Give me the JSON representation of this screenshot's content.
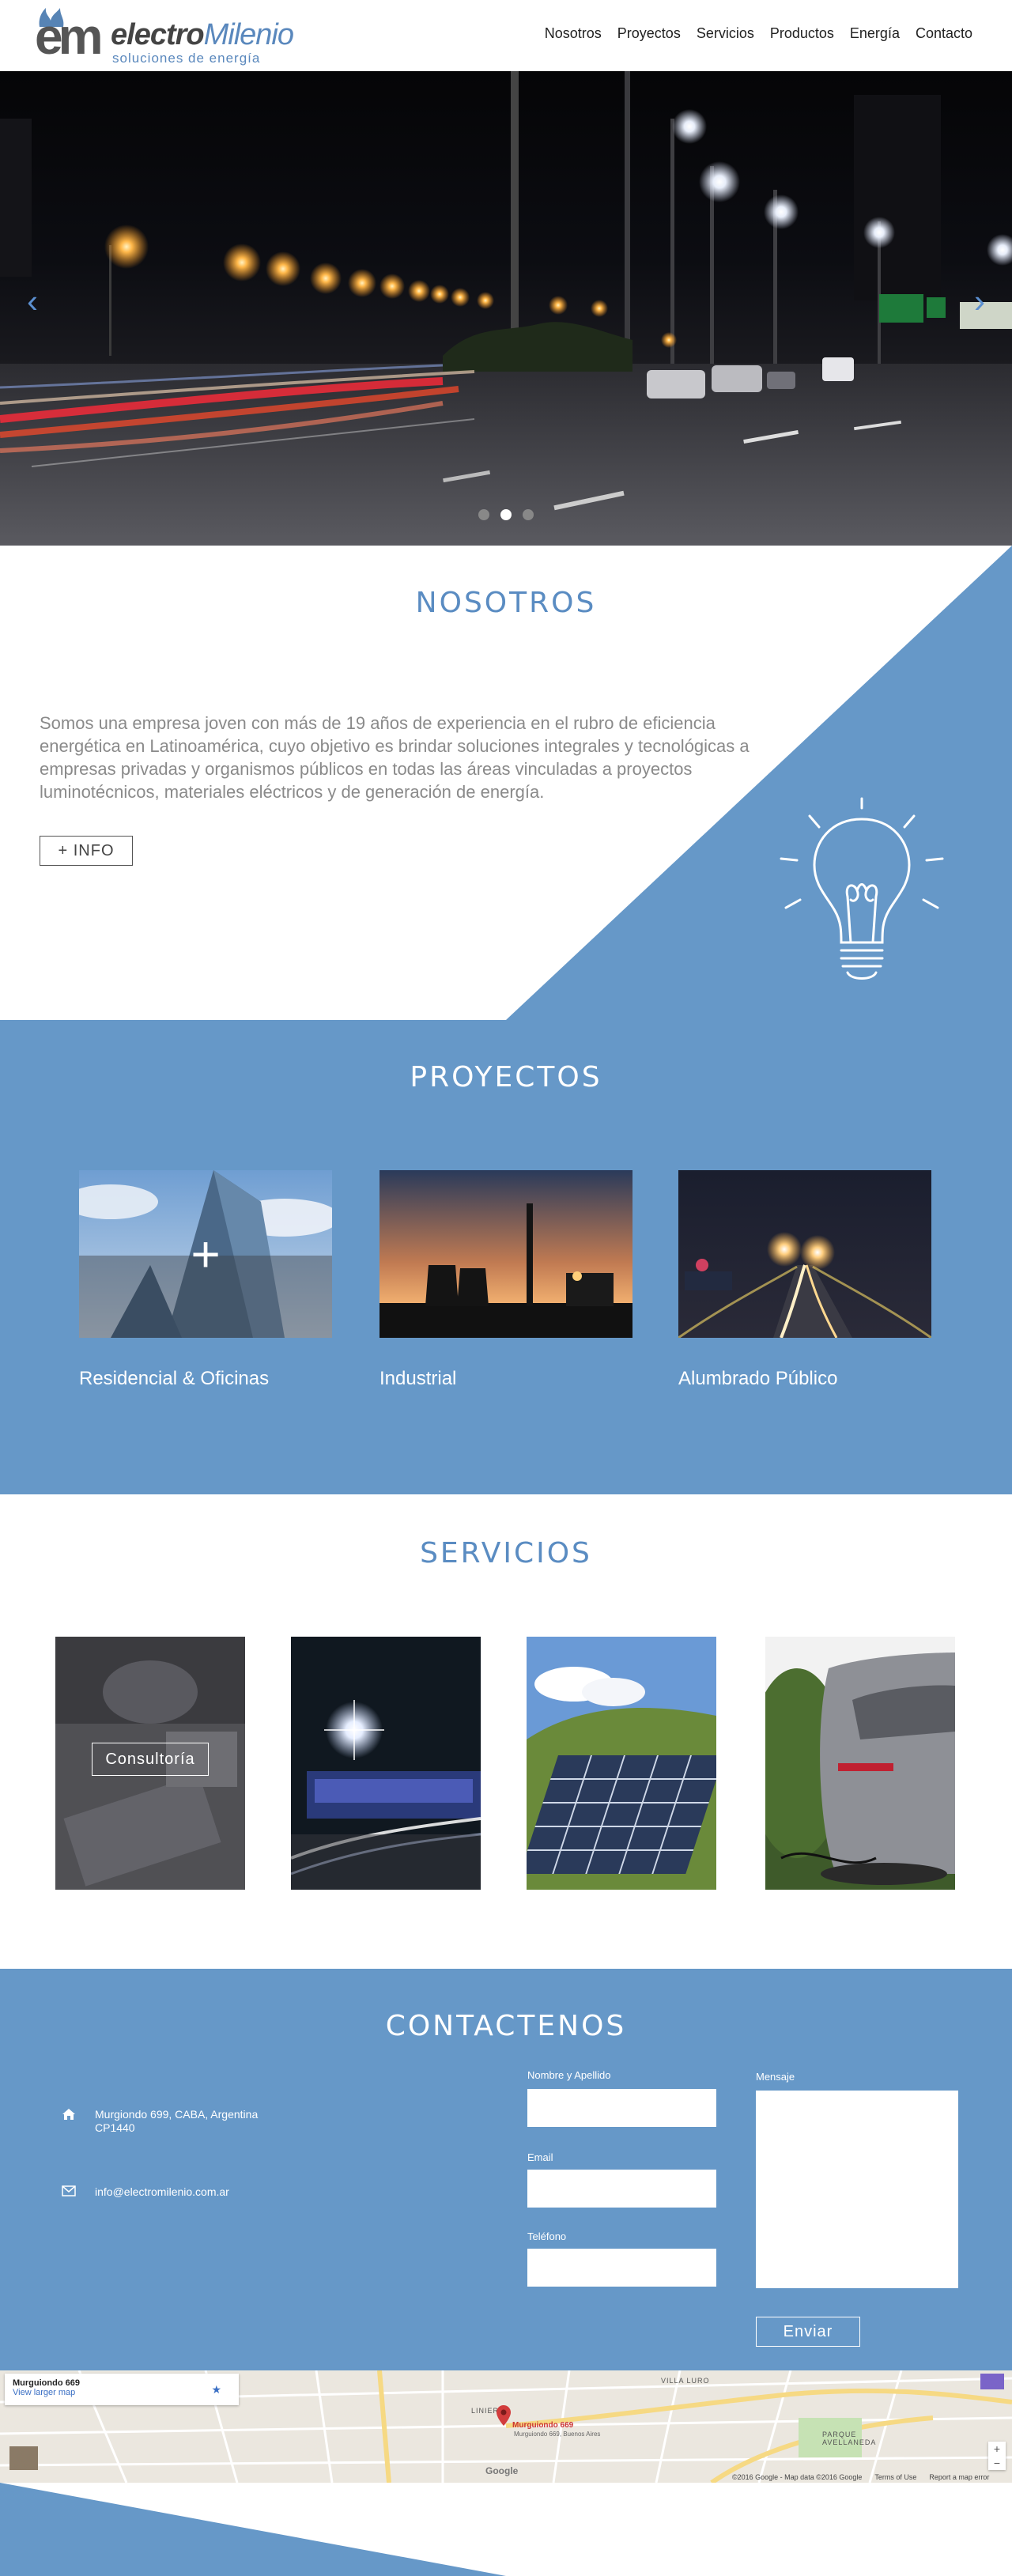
{
  "brand": {
    "logo_em": "em",
    "name_part1": "electro",
    "name_part2": "Milenio",
    "tagline": "soluciones de energía",
    "accent": "#6698c8",
    "accent_dark": "#3a6ea8"
  },
  "nav": {
    "items": [
      "Nosotros",
      "Proyectos",
      "Servicios",
      "Productos",
      "Energía",
      "Contacto"
    ]
  },
  "hero": {
    "prev_icon": "chevron-left-icon",
    "next_icon": "chevron-right-icon",
    "prev_glyph": "‹",
    "next_glyph": "›",
    "slides": 3,
    "active_slide": 2
  },
  "nosotros": {
    "title": "NOSOTROS",
    "text": "Somos una empresa joven con más de 19 años de experiencia en el rubro de eficiencia energética en Latinoamérica, cuyo objetivo es brindar soluciones integrales y tecnológicas a empresas privadas y organismos públicos en todas las áreas vinculadas a proyectos luminotécnicos, materiales eléctricos y de  generación de energía.",
    "button": "+ INFO",
    "icon": "lightbulb-icon"
  },
  "proyectos": {
    "title": "PROYECTOS",
    "items": [
      {
        "label": "Residencial & Oficinas",
        "hover_plus": "+"
      },
      {
        "label": "Industrial"
      },
      {
        "label": "Alumbrado Público"
      }
    ]
  },
  "servicios": {
    "title": "SERVICIOS",
    "items": [
      {
        "label": "Consultoría"
      },
      {
        "label": ""
      },
      {
        "label": ""
      },
      {
        "label": ""
      }
    ]
  },
  "contacto": {
    "title": "CONTACTENOS",
    "address_icon": "home-icon",
    "address": "Murgiondo 699, CABA, Argentina CP1440",
    "email_icon": "envelope-icon",
    "email": "info@electromilenio.com.ar",
    "fields": {
      "name_label": "Nombre y Apellido",
      "email_label": "Email",
      "phone_label": "Teléfono",
      "message_label": "Mensaje",
      "name_value": "",
      "email_value": "",
      "phone_value": "",
      "message_value": ""
    },
    "submit": "Enviar"
  },
  "map": {
    "card_title": "Murguiondo 669",
    "card_link": "View larger map",
    "marker_title": "Murguiondo 669",
    "marker_sub": "Murguiondo 669, Buenos Aires",
    "places": [
      "LINIERS",
      "VILLA LURO",
      "PARQUE AVELLANEDA"
    ],
    "google": "Google",
    "footer": [
      "©2016 Google - Map data ©2016 Google",
      "Terms of Use",
      "Report a map error"
    ],
    "zoom_in": "+",
    "zoom_out": "−"
  }
}
